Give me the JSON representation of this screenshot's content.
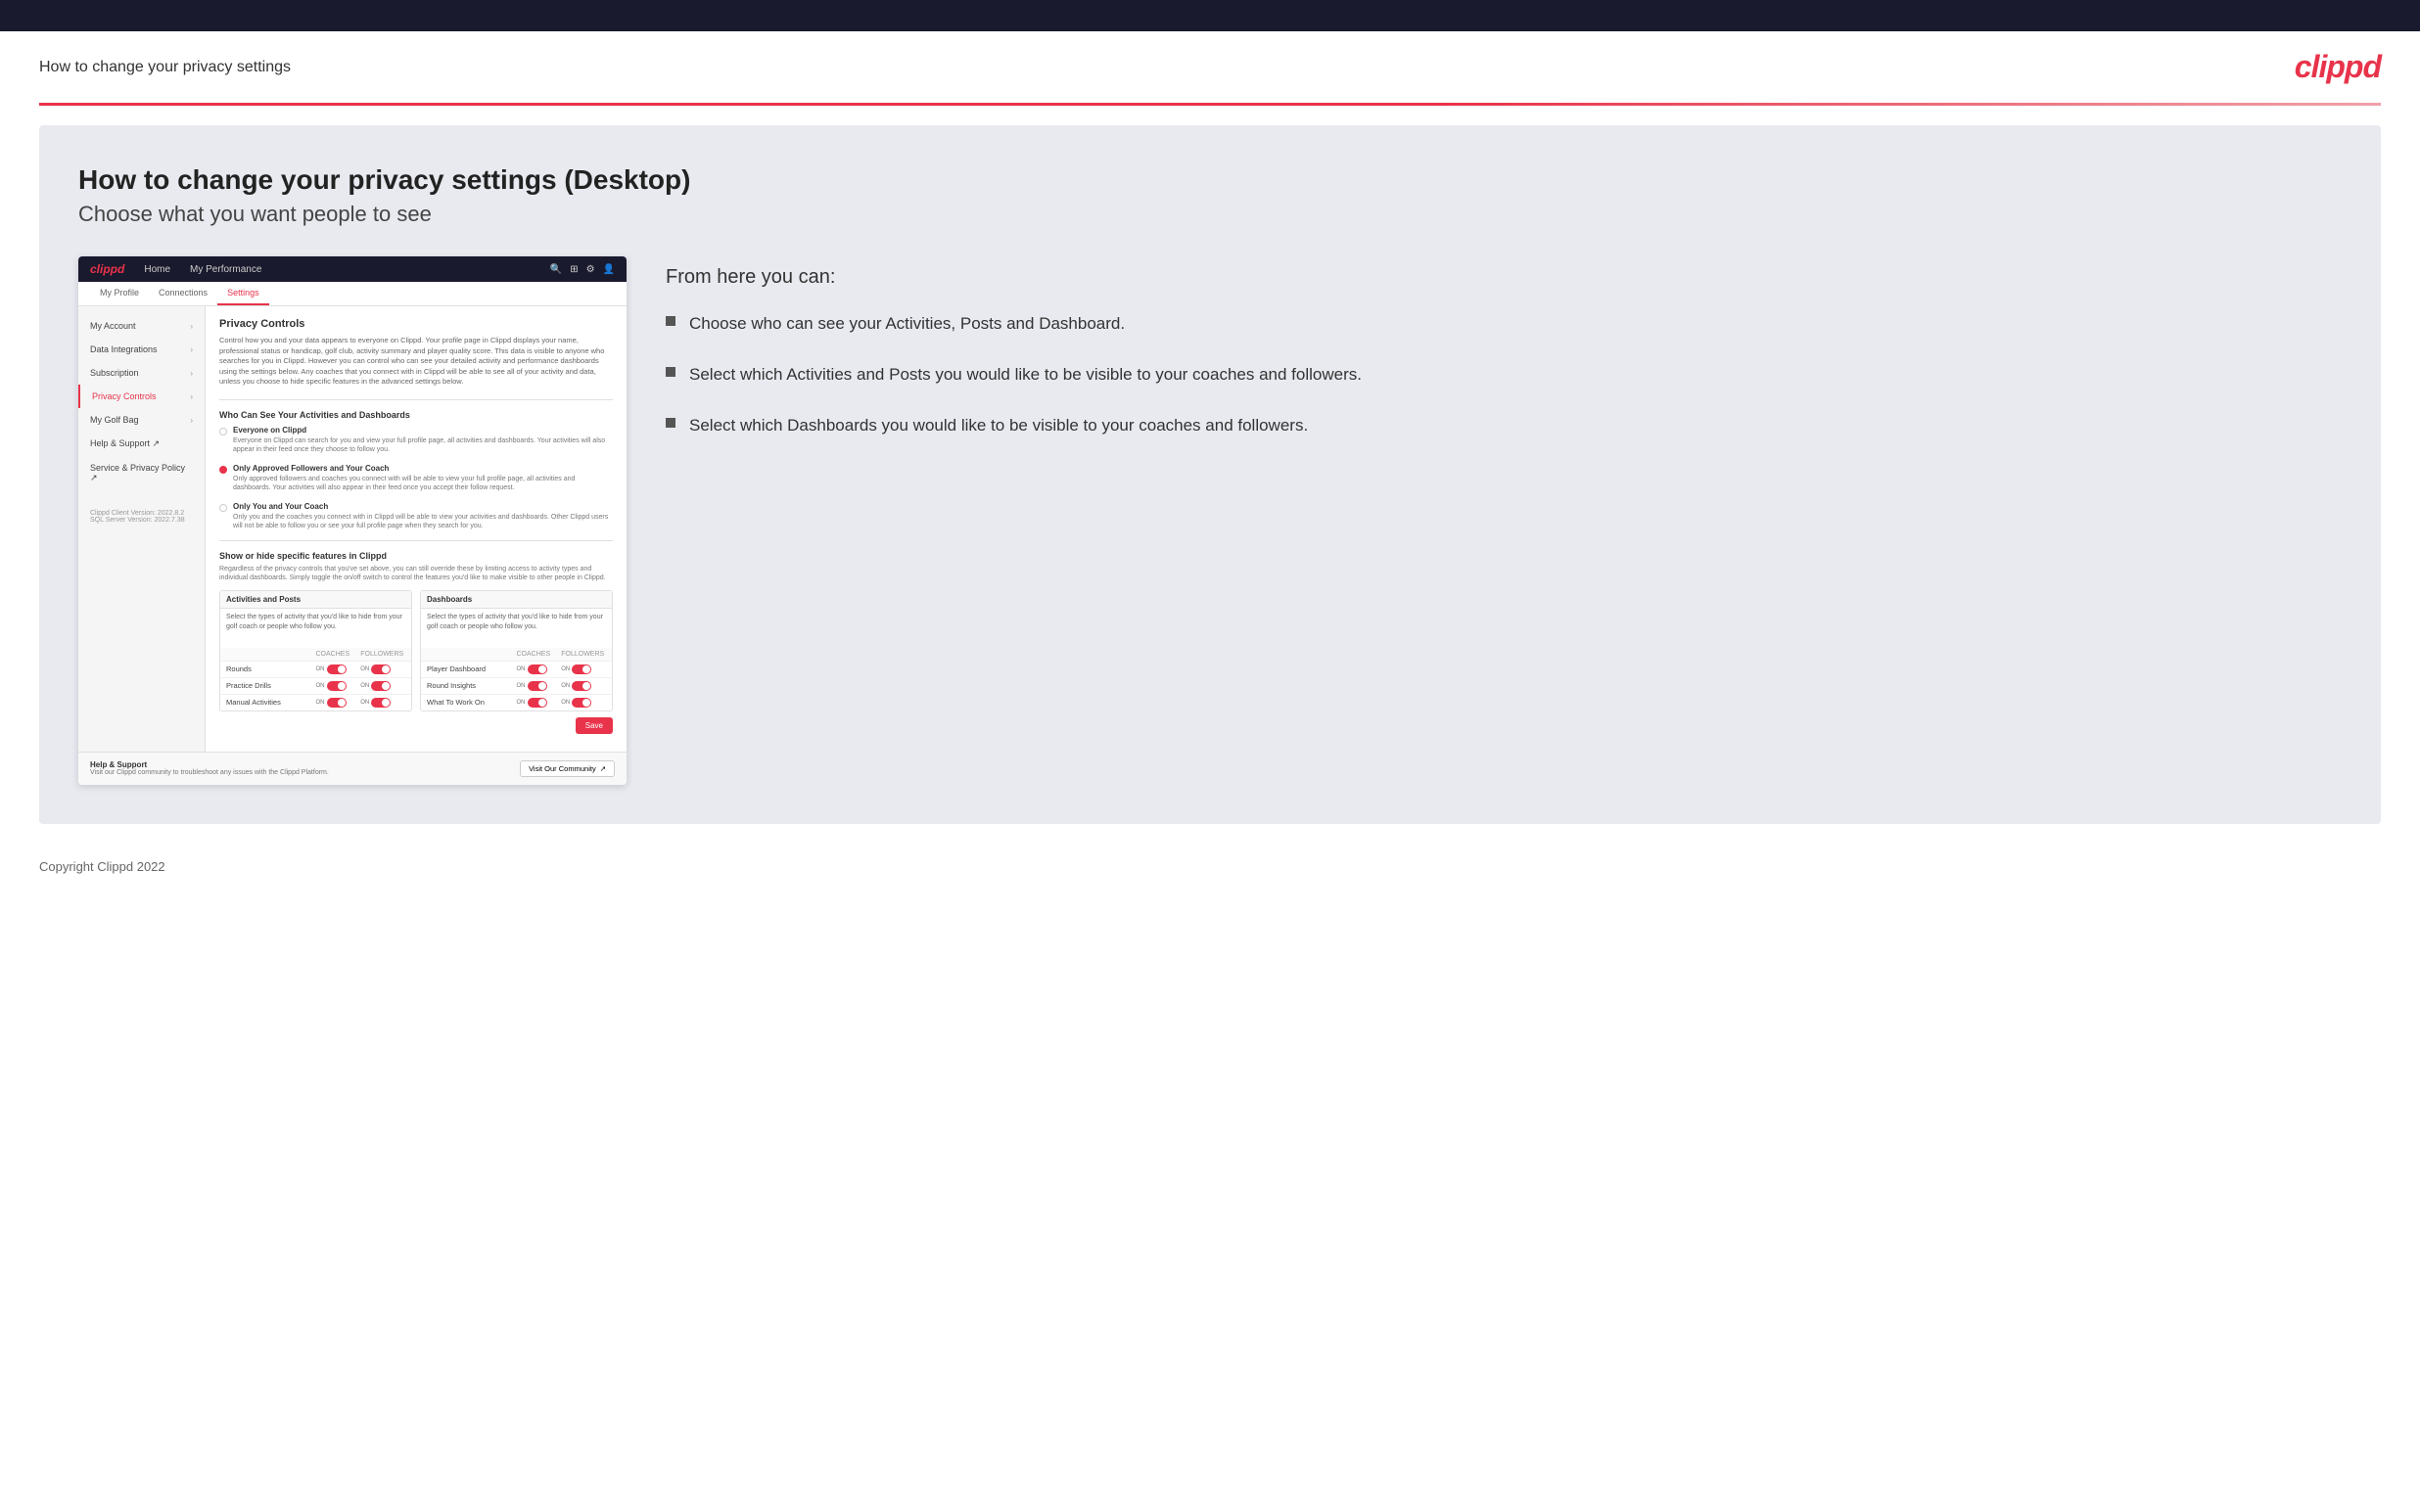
{
  "header": {
    "title": "How to change your privacy settings",
    "logo": "clippd"
  },
  "page": {
    "heading": "How to change your privacy settings (Desktop)",
    "subheading": "Choose what you want people to see"
  },
  "right_panel": {
    "from_here": "From here you can:",
    "bullets": [
      "Choose who can see your Activities, Posts and Dashboard.",
      "Select which Activities and Posts you would like to be visible to your coaches and followers.",
      "Select which Dashboards you would like to be visible to your coaches and followers."
    ]
  },
  "app_screenshot": {
    "nav": {
      "logo": "clippd",
      "links": [
        "Home",
        "My Performance"
      ]
    },
    "tabs": [
      "My Profile",
      "Connections",
      "Settings"
    ],
    "sidebar_items": [
      {
        "label": "My Account",
        "active": false
      },
      {
        "label": "Data Integrations",
        "active": false
      },
      {
        "label": "Subscription",
        "active": false
      },
      {
        "label": "Privacy Controls",
        "active": true
      },
      {
        "label": "My Golf Bag",
        "active": false
      },
      {
        "label": "Help & Support",
        "active": false
      },
      {
        "label": "Service & Privacy Policy",
        "active": false
      }
    ],
    "version": "Clippd Client Version: 2022.8.2\nSQL Server Version: 2022.7.38",
    "privacy_controls": {
      "title": "Privacy Controls",
      "description": "Control how you and your data appears to everyone on Clippd. Your profile page in Clippd displays your name, professional status or handicap, golf club, activity summary and player quality score. This data is visible to anyone who searches for you in Clippd. However you can control who can see your detailed activity and performance dashboards using the settings below. Any coaches that you connect with in Clippd will be able to see all of your activity and data, unless you choose to hide specific features in the advanced settings below.",
      "who_can_see_title": "Who Can See Your Activities and Dashboards",
      "options": [
        {
          "id": "everyone",
          "label": "Everyone on Clippd",
          "description": "Everyone on Clippd can search for you and view your full profile page, all activities and dashboards. Your activities will also appear in their feed once they choose to follow you.",
          "selected": false
        },
        {
          "id": "followers",
          "label": "Only Approved Followers and Your Coach",
          "description": "Only approved followers and coaches you connect with will be able to view your full profile page, all activities and dashboards. Your activities will also appear in their feed once you accept their follow request.",
          "selected": true
        },
        {
          "id": "coach_only",
          "label": "Only You and Your Coach",
          "description": "Only you and the coaches you connect with in Clippd will be able to view your activities and dashboards. Other Clippd users will not be able to follow you or see your full profile page when they search for you.",
          "selected": false
        }
      ],
      "show_hide_title": "Show or hide specific features in Clippd",
      "show_hide_desc": "Regardless of the privacy controls that you've set above, you can still override these by limiting access to activity types and individual dashboards. Simply toggle the on/off switch to control the features you'd like to make visible to other people in Clippd.",
      "activities_posts": {
        "title": "Activities and Posts",
        "description": "Select the types of activity that you'd like to hide from your golf coach or people who follow you.",
        "col_coaches": "COACHES",
        "col_followers": "FOLLOWERS",
        "rows": [
          {
            "label": "Rounds",
            "coaches": "ON",
            "followers": "ON"
          },
          {
            "label": "Practice Drills",
            "coaches": "ON",
            "followers": "ON"
          },
          {
            "label": "Manual Activities",
            "coaches": "ON",
            "followers": "ON"
          }
        ]
      },
      "dashboards": {
        "title": "Dashboards",
        "description": "Select the types of activity that you'd like to hide from your golf coach or people who follow you.",
        "col_coaches": "COACHES",
        "col_followers": "FOLLOWERS",
        "rows": [
          {
            "label": "Player Dashboard",
            "coaches": "ON",
            "followers": "ON"
          },
          {
            "label": "Round Insights",
            "coaches": "ON",
            "followers": "ON"
          },
          {
            "label": "What To Work On",
            "coaches": "ON",
            "followers": "ON"
          }
        ]
      },
      "save_label": "Save"
    },
    "help": {
      "title": "Help & Support",
      "desc": "Visit our Clippd community to troubleshoot any issues with the Clippd Platform.",
      "button": "Visit Our Community"
    }
  },
  "footer": {
    "text": "Copyright Clippd 2022"
  }
}
